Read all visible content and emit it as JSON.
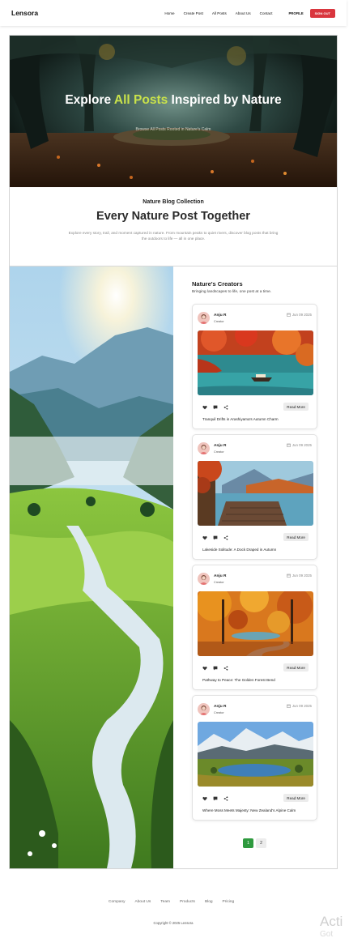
{
  "nav": {
    "brand": "Lensora",
    "links": [
      "Home",
      "Create Post",
      "All Posts",
      "About Us",
      "Contact"
    ],
    "profile": "PROFILE",
    "signout": "SIGN OUT"
  },
  "hero": {
    "title_before": "Explore ",
    "title_accent": "All Posts",
    "title_after": " Inspired by Nature",
    "subtitle": "Browse All Posts Rooted in Nature's Calm"
  },
  "intro": {
    "label": "Nature Blog Collection",
    "title": "Every Nature Post Together",
    "description": "Explore every story, trail, and moment captured in nature. From mountain peaks to quiet rivers, discover blog posts that bring the outdoors to life — all in one place."
  },
  "sidebar": {
    "title": "Nature's Creators",
    "subtitle": "Bringing landscapes to life, one post at a time."
  },
  "posts": [
    {
      "author": "Anju R",
      "role": "Creator",
      "date": "Jun 09 2025",
      "read_more": "Read More",
      "title": "Tranquil Drifts in Arashiyama's Autumn Charm",
      "image": "autumn-lake-boat"
    },
    {
      "author": "Anju R",
      "role": "Creator",
      "date": "Jun 09 2025",
      "read_more": "Read More",
      "title": "Lakeside Solitude: A Dock Draped in Autumn",
      "image": "lake-dock"
    },
    {
      "author": "Anju R",
      "role": "Creator",
      "date": "Jun 09 2025",
      "read_more": "Read More",
      "title": "Pathway to Peace: The Golden Forest Bend",
      "image": "golden-forest-path"
    },
    {
      "author": "Anju R",
      "role": "Creator",
      "date": "Jun 09 2025",
      "read_more": "Read More",
      "title": "Where Moss Meets Majesty: New Zealand's Alpine Calm",
      "image": "alpine-lake"
    }
  ],
  "pagination": {
    "pages": [
      "1",
      "2"
    ],
    "active": "1"
  },
  "footer": {
    "links": [
      "Company",
      "About Us",
      "Team",
      "Products",
      "Blog",
      "Pricing"
    ],
    "copyright": "Copyright © 2025 Lensora"
  },
  "watermark": {
    "line1": "Acti",
    "line2": "Got"
  },
  "colors": {
    "accent": "#c9e24a",
    "signout": "#d9363e",
    "page_active": "#2f9a3f"
  }
}
